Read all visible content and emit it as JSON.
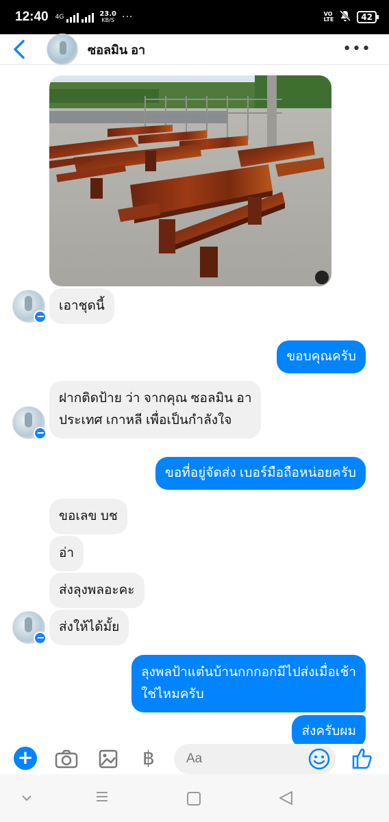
{
  "status": {
    "time": "12:40",
    "network": "4G",
    "speed_value": "23.0",
    "speed_unit": "KB/S",
    "dots": "···",
    "volte_top": "VO",
    "volte_bottom": "LTE",
    "battery": "42"
  },
  "header": {
    "contact_name": "ซอลมิน อา"
  },
  "messages": {
    "in_1": "เอาชุดนี้",
    "out_1": "ขอบคุณครับ",
    "in_2_line1": "ฝากติดป้าย ว่า จากคุณ ซอลมิน อา",
    "in_2_line2": "ประเทศ เกาหลี  เพื่อเป็นกำลังใจ",
    "out_2": "ขอที่อยู่จัดส่ง เบอร์มือถือหน่อยครับ",
    "in_3": "ขอเลข บช",
    "in_4": "อ่า",
    "in_5": "ส่งลุงพลอะคะ",
    "in_6": "ส่งให้ได้มั้ย",
    "out_3_line1": "ลุงพลป้าแต๋นบ้านกกกอกมีไปส่งเมื่อเช้า",
    "out_3_line2": "ใช่ไหมครับ",
    "out_4": "ส่งครับผม"
  },
  "composer": {
    "placeholder": "Aa",
    "baht_symbol": "฿"
  },
  "colors": {
    "accent": "#0084ff",
    "incoming_bubble": "#f0f0f0"
  },
  "icons": [
    "back-arrow-icon",
    "more-icon",
    "plus-icon",
    "camera-icon",
    "gallery-icon",
    "baht-icon",
    "emoji-icon",
    "thumbs-up-icon",
    "nav-back-icon",
    "nav-home-icon",
    "nav-recent-icon"
  ]
}
